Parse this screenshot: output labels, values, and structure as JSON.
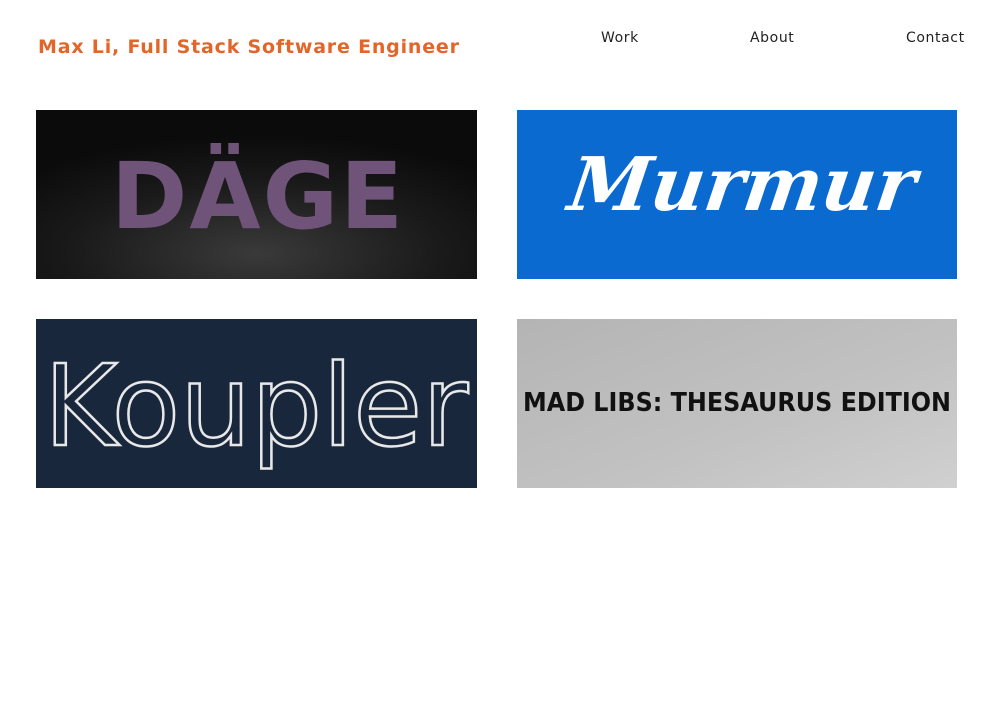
{
  "header": {
    "site_title": "Max Li, Full Stack Software Engineer",
    "nav": {
      "work": "Work",
      "about": "About",
      "contact": "Contact"
    }
  },
  "projects": [
    {
      "logo_text": "DÄGE",
      "background": "#111111",
      "text_color": "#6f5379"
    },
    {
      "logo_text": "Murmur",
      "background": "#0a6ad0",
      "text_color": "#ffffff"
    },
    {
      "logo_text": "Koupler",
      "background": "#19273c",
      "text_color": "#e8e8e8"
    },
    {
      "logo_text": "MAD LIBS: THESAURUS EDITION",
      "background": "#bdbdbd",
      "text_color": "#111111"
    }
  ],
  "colors": {
    "accent": "#e2652a",
    "nav_text": "#222222",
    "page_background": "#ffffff"
  }
}
